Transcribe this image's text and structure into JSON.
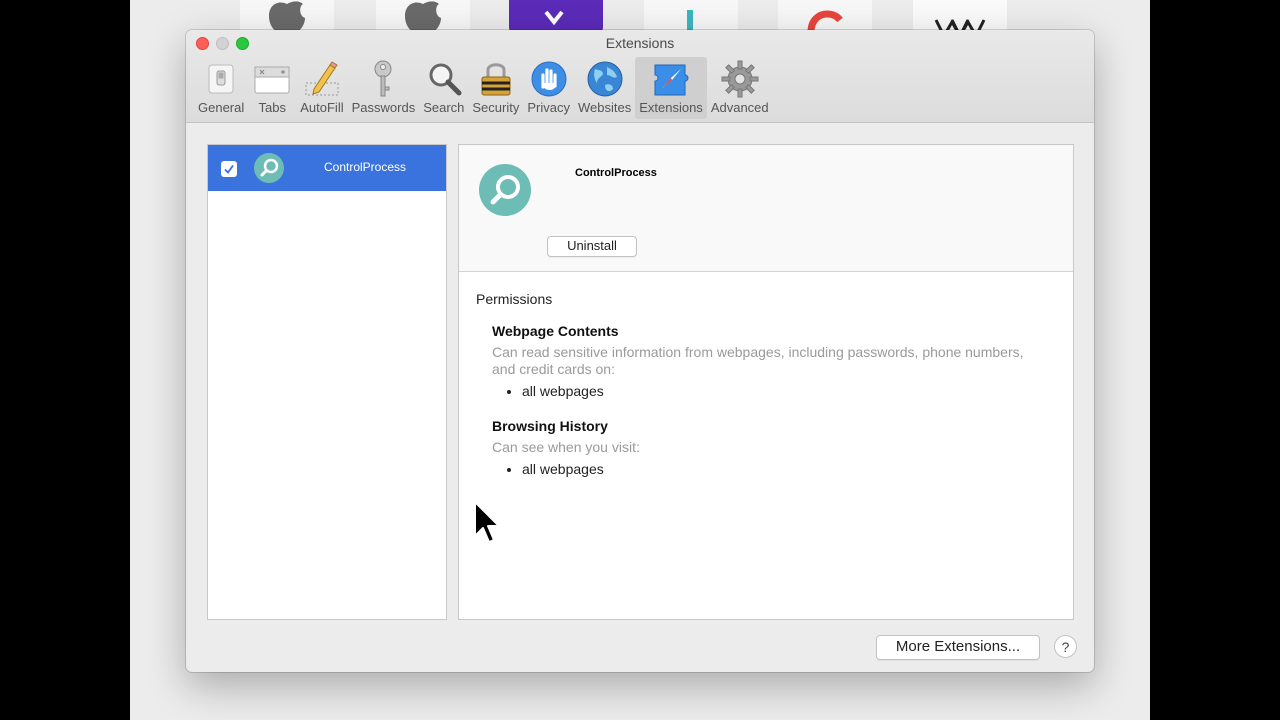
{
  "window": {
    "title": "Extensions"
  },
  "toolbar": {
    "items": [
      {
        "label": "General",
        "icon": "switch-icon"
      },
      {
        "label": "Tabs",
        "icon": "tabs-icon"
      },
      {
        "label": "AutoFill",
        "icon": "pencil-icon"
      },
      {
        "label": "Passwords",
        "icon": "key-icon"
      },
      {
        "label": "Search",
        "icon": "magnifier-icon"
      },
      {
        "label": "Security",
        "icon": "lock-icon"
      },
      {
        "label": "Privacy",
        "icon": "hand-icon"
      },
      {
        "label": "Websites",
        "icon": "globe-icon"
      },
      {
        "label": "Extensions",
        "icon": "puzzle-compass-icon"
      },
      {
        "label": "Advanced",
        "icon": "gear-icon"
      }
    ],
    "active": "Extensions"
  },
  "extension_list": {
    "items": [
      {
        "name": "ControlProcess",
        "enabled": true
      }
    ]
  },
  "detail": {
    "name": "ControlProcess",
    "uninstall_label": "Uninstall",
    "permissions_heading": "Permissions",
    "permissions": [
      {
        "title": "Webpage Contents",
        "description": "Can read sensitive information from webpages, including passwords, phone numbers, and credit cards on:",
        "items": [
          "all webpages"
        ]
      },
      {
        "title": "Browsing History",
        "description": "Can see when you visit:",
        "items": [
          "all webpages"
        ]
      }
    ]
  },
  "footer": {
    "more_label": "More Extensions...",
    "help_label": "?"
  },
  "colors": {
    "selection": "#3a73dd",
    "extension_icon": "#6dbcb6",
    "close": "#fd5f57",
    "zoom": "#2ac840"
  }
}
